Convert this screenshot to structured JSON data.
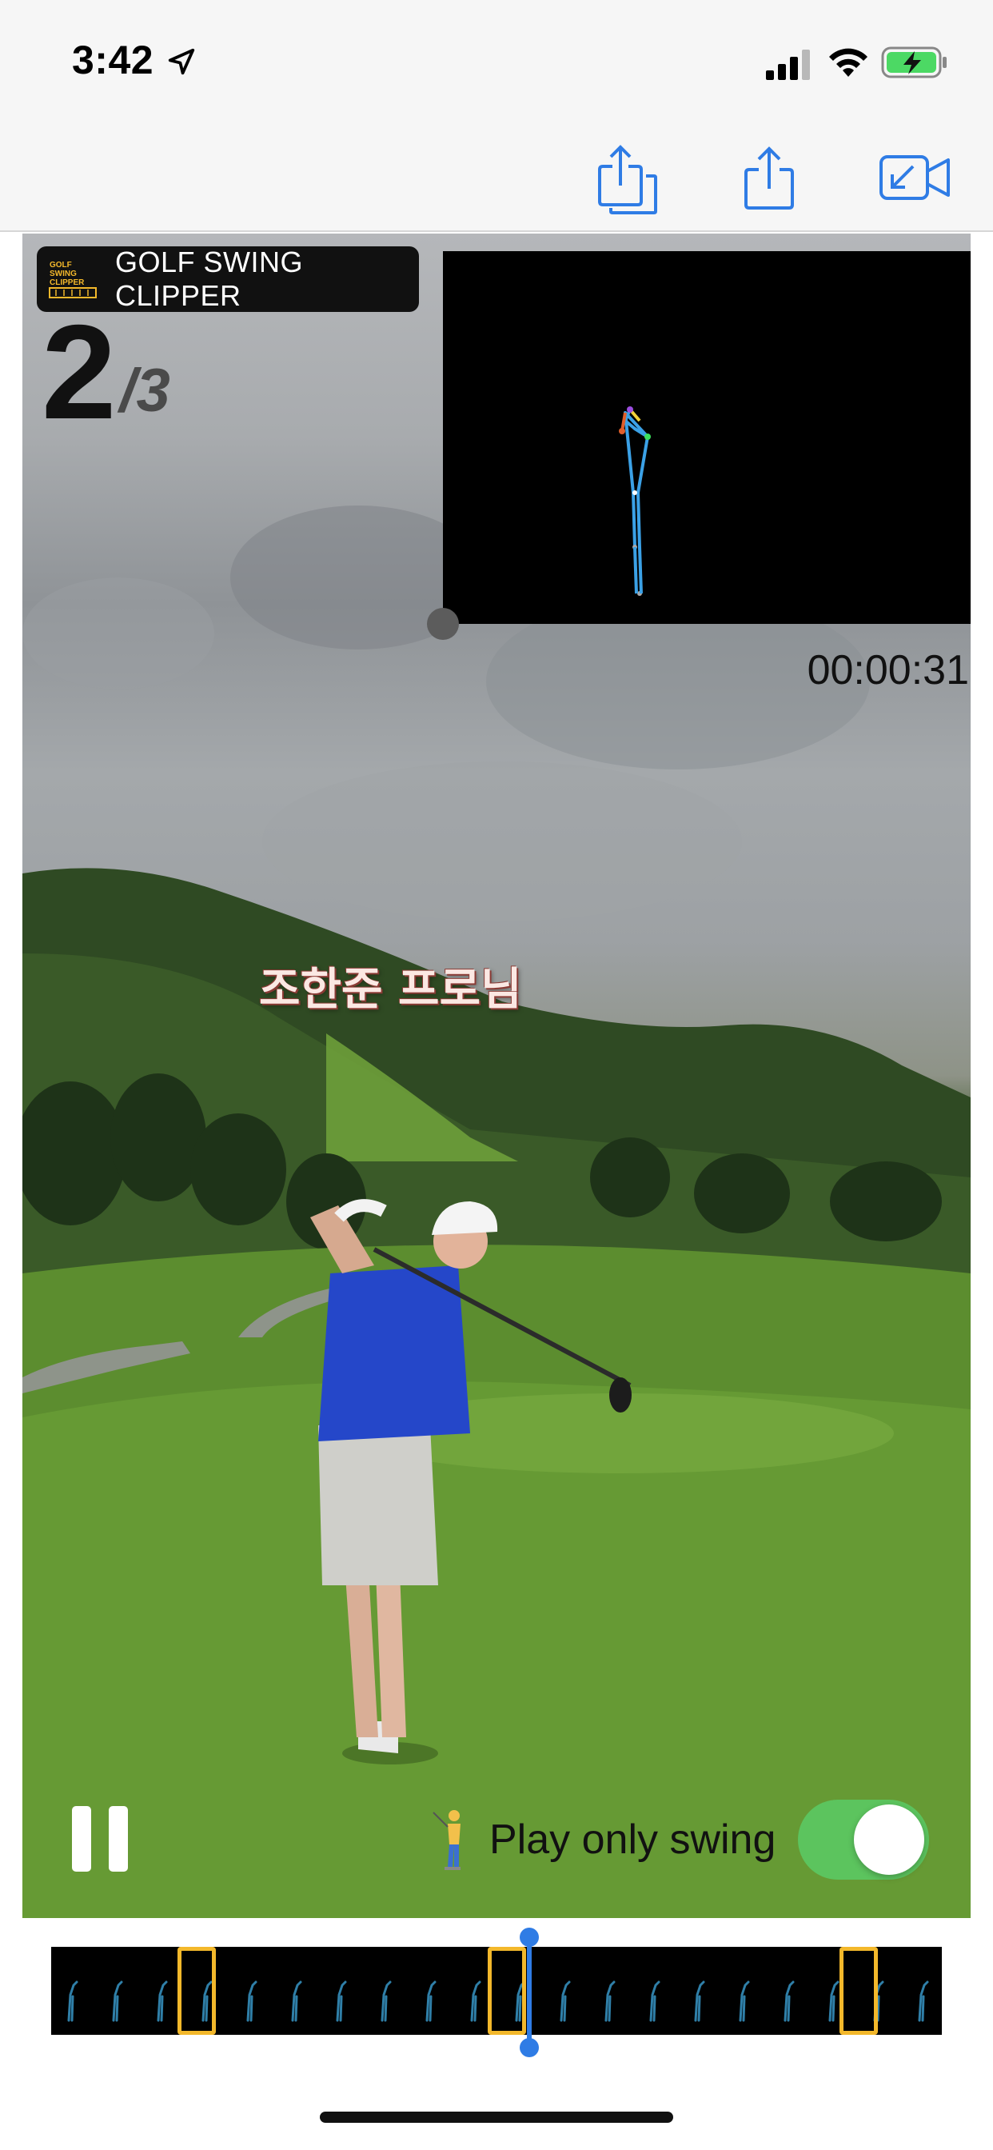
{
  "status_bar": {
    "time": "3:42",
    "icons": [
      "location-arrow-icon",
      "cellular-signal-icon",
      "wifi-icon",
      "battery-charging-icon"
    ],
    "battery_color": "#4cd964"
  },
  "nav_bar": {
    "buttons": [
      "share-clips-icon",
      "share-icon",
      "video-import-icon"
    ],
    "accent_color": "#2f7ce5"
  },
  "video": {
    "brand_label": "GOLF SWING CLIPPER",
    "brand_logo_text": "GOLF SWING CLIPPER",
    "clip_current": "2",
    "clip_total": "/3",
    "timestamp": "00:00:31",
    "caption": "조한준 프로님"
  },
  "controls": {
    "play_only_swing_label": "Play only swing",
    "play_only_swing_enabled": true,
    "toggle_color": "#5cc45e",
    "pause_icon": "pause-icon",
    "golfer_icon": "golfer-emoji-icon"
  },
  "timeline": {
    "swing_marker_color": "#f3b82b",
    "playhead_color": "#2f7ce5",
    "swing_markers": 3
  }
}
